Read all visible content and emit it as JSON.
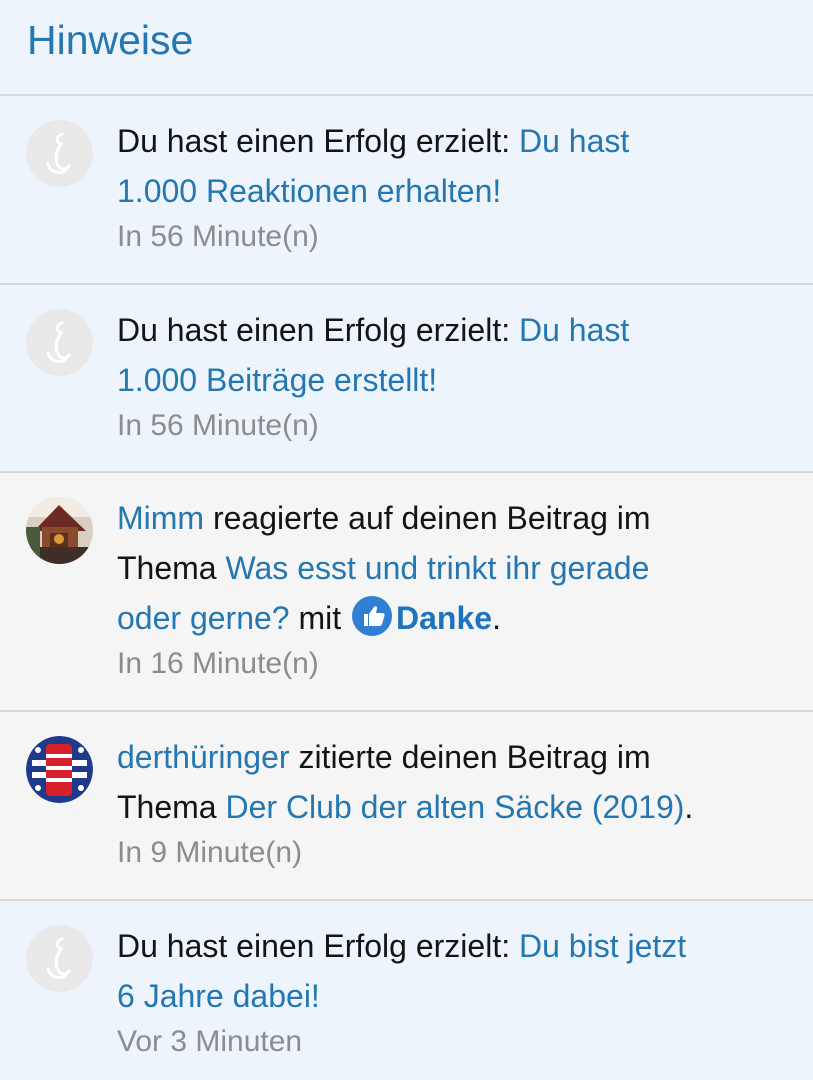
{
  "header": {
    "title": "Hinweise"
  },
  "notifications": [
    {
      "prefix": "Du hast einen Erfolg erzielt: ",
      "link_line1": "Du hast",
      "link_line2": "1.000 Reaktionen erhalten!",
      "time": "In 56 Minute(n)",
      "unread": true
    },
    {
      "prefix": "Du hast einen Erfolg erzielt: ",
      "link_line1": "Du hast",
      "link_line2": "1.000 Beiträge erstellt!",
      "time": "In 56 Minute(n)",
      "unread": true
    },
    {
      "user": "Mimm",
      "action": " reagierte auf deinen Beitrag im",
      "thema": "Thema ",
      "thread_line1": "Was esst und trinkt ihr gerade",
      "thread_line2": "oder gerne?",
      "mit": " mit ",
      "reaction": "Danke",
      "end": ".",
      "time": "In 16 Minute(n)",
      "unread": false
    },
    {
      "user": "derthüringer",
      "action": " zitierte deinen Beitrag im",
      "thema": "Thema ",
      "thread": "Der Club der alten Säcke (2019)",
      "end": ".",
      "time": "In 9 Minute(n)",
      "unread": false
    },
    {
      "prefix": "Du hast einen Erfolg erzielt: ",
      "link_line1": "Du bist jetzt",
      "link_line2": "6 Jahre dabei!",
      "time": "Vor 3 Minuten",
      "unread": true
    }
  ],
  "colors": {
    "accent": "#2577b1",
    "unread_bg": "#edf4fb",
    "read_bg": "#f5f5f5",
    "like_icon": "#2f7fd5"
  }
}
